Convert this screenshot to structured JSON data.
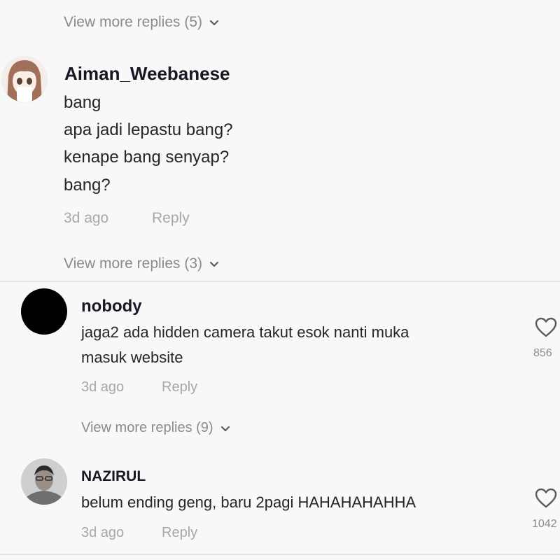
{
  "thread_top": {
    "view_more_label": "View more replies (5)"
  },
  "comment1": {
    "username": "Aiman_Weebanese",
    "lines": [
      "bang",
      "apa jadi lepastu bang?",
      "kenape bang senyap?",
      "bang?"
    ],
    "time": "3d ago",
    "reply_label": "Reply",
    "view_more_label": "View more replies (3)"
  },
  "comment2": {
    "username": "nobody",
    "lines": [
      "jaga2 ada hidden camera takut esok nanti muka",
      "masuk website"
    ],
    "time": "3d ago",
    "reply_label": "Reply",
    "like_count": "856",
    "view_more_label": "View more replies (9)"
  },
  "comment3": {
    "username": "NAZIRUL",
    "lines": [
      "belum ending geng, baru 2pagi HAHAHAHAHHA"
    ],
    "time": "3d ago",
    "reply_label": "Reply",
    "like_count": "1042"
  },
  "icons": {
    "chevron": "chevron-down-icon",
    "heart": "heart-icon"
  },
  "colors": {
    "background": "#f8f8f8",
    "muted": "#8a8b91",
    "divider": "#e3e3e4"
  }
}
